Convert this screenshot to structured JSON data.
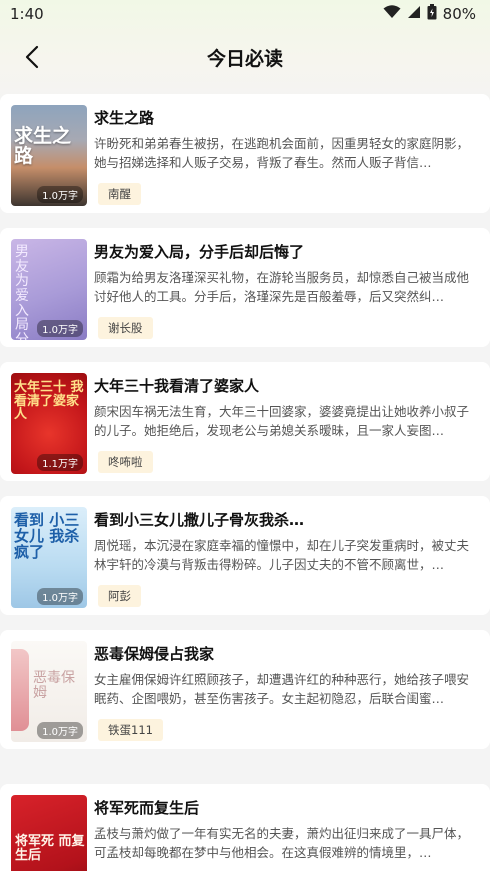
{
  "status": {
    "time": "1:40",
    "battery": "80%"
  },
  "header": {
    "title": "今日必读"
  },
  "books": [
    {
      "title": "求生之路",
      "desc": "许盼死和弟弟春生被拐，在逃跑机会面前，因重男轻女的家庭阴影，她与招娣选择和人贩子交易，背叛了春生。然而人贩子背信…",
      "author": "南醒",
      "word_count": "1.0万字",
      "cover_text": "求生之路"
    },
    {
      "title": "男友为爱入局，分手后却后悔了",
      "desc": "顾霜为给男友洛瑾深买礼物，在游轮当服务员，却惊悉自己被当成他讨好他人的工具。分手后，洛瑾深先是百般羞辱，后又突然纠…",
      "author": "谢长股",
      "word_count": "1.0万字",
      "cover_text": "男友为爱入局 分手后悔"
    },
    {
      "title": "大年三十我看清了婆家人",
      "desc": "颜宋因车祸无法生育，大年三十回婆家，婆婆竟提出让她收养小叔子的儿子。她拒绝后，发现老公与弟媳关系暧昧，且一家人妄图…",
      "author": "咚咘啦",
      "word_count": "1.1万字",
      "cover_text": "大年三十 我看清了婆家人"
    },
    {
      "title": "看到小三女儿撒儿子骨灰我杀…",
      "desc": "周悦瑶，本沉浸在家庭幸福的憧憬中，却在儿子突发重病时，被丈夫林宇轩的冷漠与背叛击得粉碎。儿子因丈夫的不管不顾离世，…",
      "author": "阿彭",
      "word_count": "1.0万字",
      "cover_text": "看到 小三女儿 我杀疯了"
    },
    {
      "title": "恶毒保姆侵占我家",
      "desc": "女主雇佣保姆许红照顾孩子，却遭遇许红的种种恶行，她给孩子喂安眠药、企图喂奶，甚至伤害孩子。女主起初隐忍，后联合闺蜜…",
      "author": "铁蛋111",
      "word_count": "1.0万字",
      "cover_text": "恶毒保姆"
    },
    {
      "title": "将军死而复生后",
      "desc": "孟枝与萧灼做了一年有实无名的夫妻，萧灼出征归来成了一具尸体，可孟枝却每晚都在梦中与他相会。在这真假难辨的情境里，…",
      "author": "",
      "word_count": "",
      "cover_text": "将军死 而复生后"
    }
  ],
  "colors": {
    "author_tag_bg": "#fdf3de",
    "background": "#f4f4f4"
  }
}
